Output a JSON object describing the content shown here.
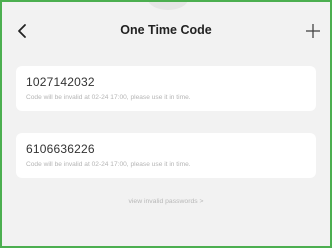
{
  "header": {
    "title": "One Time Code",
    "back_icon": "chevron-left-icon",
    "add_icon": "plus-icon"
  },
  "codes": [
    {
      "code": "1027142032",
      "note": "Code will be invalid at 02-24 17:00, please use it in time."
    },
    {
      "code": "6106636226",
      "note": "Code will be invalid at 02-24 17:00, please use it in time."
    }
  ],
  "footer": {
    "link_label": "view invalid passwords >"
  },
  "colors": {
    "frame_border": "#4caf50",
    "background": "#f2f2f2",
    "card": "#ffffff"
  }
}
